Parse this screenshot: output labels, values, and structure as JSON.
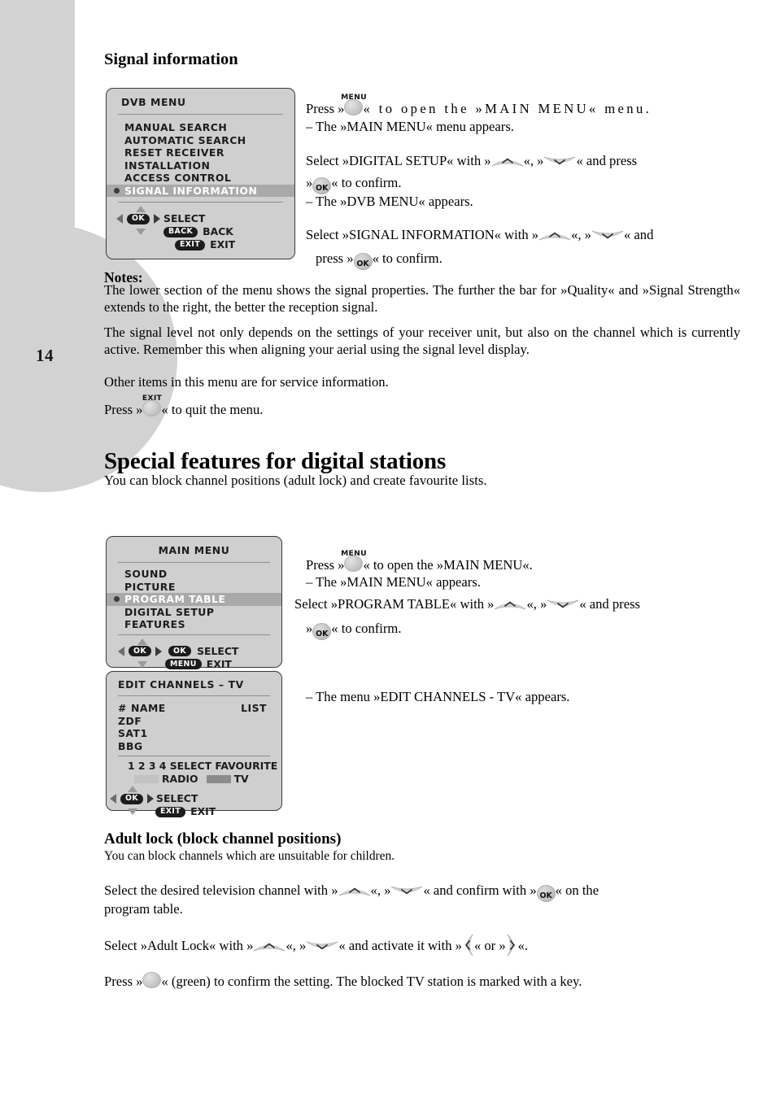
{
  "page": {
    "number": "14"
  },
  "section1": {
    "heading": "Signal information",
    "osd": {
      "title": "DVB MENU",
      "items": [
        {
          "label": "MANUAL SEARCH",
          "highlighted": false
        },
        {
          "label": "AUTOMATIC SEARCH",
          "highlighted": false
        },
        {
          "label": "RESET RECEIVER",
          "highlighted": false
        },
        {
          "label": "INSTALLATION",
          "highlighted": false
        },
        {
          "label": "ACCESS CONTROL",
          "highlighted": false
        },
        {
          "label": "SIGNAL INFORMATION",
          "highlighted": true
        }
      ],
      "nav": {
        "ok_pill": "OK",
        "select_label": "SELECT",
        "back_pill": "BACK",
        "back_label": "BACK",
        "exit_pill": "EXIT",
        "exit_label": "EXIT"
      }
    },
    "steps": {
      "press_pre": "Press »",
      "press_post": "« to open the »MAIN MENU« menu.",
      "press_result": "– The »MAIN MENU« menu appears.",
      "select_digital_pre": "Select »DIGITAL SETUP«  with  »",
      "select_digital_mid": "«, »",
      "select_digital_post": "« and  press",
      "confirm_pre": "»",
      "confirm_post": "« to confirm.",
      "dvb_result": "– The »DVB MENU« appears.",
      "select_signal_pre": "Select  »SIGNAL INFORMATION«   with  »",
      "select_signal_mid": "«, »",
      "select_signal_post": "« and",
      "press_confirm_pre": "press »",
      "press_confirm_post": "« to confirm."
    },
    "notes": {
      "label": "Notes:",
      "para1": "The  lower  section  of  the  menu  shows  the  signal  properties.  The  further  the  bar  for »Quality«  and  »Signal  Strength«  extends  to the right, the better the reception signal.",
      "para2": "The   signal   level  not   only   depends   on   the   settings   of  your receiver unit, but also  on  the  channel  which  is  currently  active. Remember  this  when  aligning  your  aerial using  the  signal level display.",
      "para3": "Other items in this menu are for service information.",
      "quit_pre": "Press »",
      "quit_post": "« to quit the menu."
    }
  },
  "section2": {
    "heading": "Special features for digital stations",
    "intro": "You  can  block     channel     positions     (adult  lock)  and  create  favourite  lists.",
    "main_menu_osd": {
      "title": "MAIN MENU",
      "items": [
        {
          "label": "SOUND",
          "highlighted": false
        },
        {
          "label": "PICTURE",
          "highlighted": false
        },
        {
          "label": "PROGRAM TABLE",
          "highlighted": true
        },
        {
          "label": "DIGITAL SETUP",
          "highlighted": false
        },
        {
          "label": "FEATURES",
          "highlighted": false
        }
      ],
      "nav": {
        "ok_pill": "OK",
        "ok_pill2": "OK",
        "select_label": "SELECT",
        "menu_pill": "MENU",
        "exit_label": "EXIT"
      }
    },
    "edit_channels_osd": {
      "title": "EDIT CHANNELS – TV",
      "col_num": "#",
      "col_name": "NAME",
      "col_list": "LIST",
      "rows": [
        "ZDF",
        "SAT1",
        "BBG"
      ],
      "favourite_line": "1 2 3 4 SELECT FAVOURITE",
      "radio_label": "RADIO",
      "tv_label": "TV",
      "nav": {
        "ok_pill": "OK",
        "select_label": "SELECT",
        "exit_pill": "EXIT",
        "exit_label": "EXIT"
      }
    },
    "steps": {
      "press_pre": "Press »",
      "press_post": "« to open the »MAIN MENU«.",
      "press_result": "–   The   »MAIN   MENU«   appears.",
      "select_pre": "Select  »PROGRAM TABLE«  with  »",
      "select_mid": "«, »",
      "select_post": "« and  press",
      "confirm_pre": "»",
      "confirm_post": "«  to  confirm.",
      "edit_result": "– The menu »EDIT CHANNELS - TV« appears."
    }
  },
  "section3": {
    "heading": "Adult lock (block channel positions)",
    "intro": "You can block channels which are unsuitable for children.",
    "step1_pre": "Select  the  desired  television  channel  with  »",
    "step1_mid": "«, »",
    "step1_post": "« and confirm with »",
    "step1_tail": "« on the",
    "step1_line2": "program table.",
    "step2_pre": "Select   »Adult   Lock«   with  »",
    "step2_mid": "«, »",
    "step2_post": "«  and   activate   it   with »",
    "step2_or": "« or »",
    "step2_tail": "«.",
    "step3_pre": "Press »",
    "step3_post": "« (green) to confirm the setting. The blocked TV station is marked with a key."
  },
  "icons": {
    "menu_cap": "MENU",
    "exit_cap": "EXIT",
    "ok_label": "OK"
  },
  "colors": {
    "margin_gray": "#d2d2d2",
    "osd_bg": "#cfcfcf",
    "osd_border": "#3a3a3a",
    "osd_highlight": "#a9a9a9",
    "pill_bg": "#1c1c1c"
  }
}
